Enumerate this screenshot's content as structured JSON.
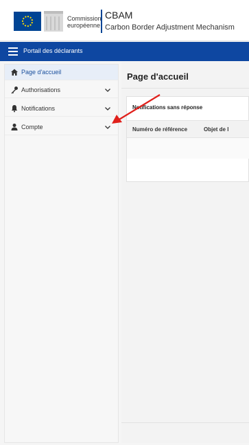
{
  "header": {
    "commission_line1": "Commission",
    "commission_line2": "européenne",
    "app_title": "CBAM",
    "app_subtitle": "Carbon Border Adjustment Mechanism"
  },
  "navbar": {
    "label": "Portail des déclarants"
  },
  "sidebar": {
    "items": [
      {
        "label": "Page d'accueil",
        "icon": "home-icon",
        "active": true
      },
      {
        "label": "Authorisations",
        "icon": "key-icon",
        "expandable": true
      },
      {
        "label": "Notifications",
        "icon": "bell-icon",
        "expandable": true
      },
      {
        "label": "Compte",
        "icon": "user-icon",
        "expandable": true
      }
    ]
  },
  "main": {
    "page_title": "Page d'accueil",
    "card": {
      "title": "Notifications sans réponse",
      "columns": [
        "Numéro de référence",
        "Objet de l"
      ]
    }
  },
  "colors": {
    "navbar": "#0e47a1",
    "active_item": "#e7eef8",
    "annotation_arrow": "#e0201b"
  }
}
